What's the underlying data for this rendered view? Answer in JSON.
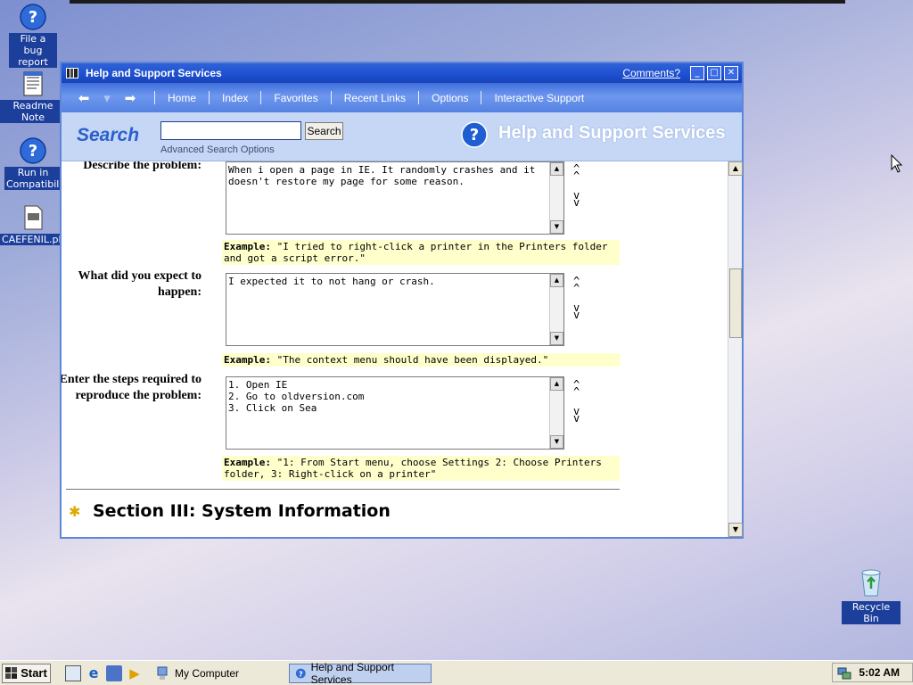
{
  "desktop": {
    "icons": [
      {
        "label": "File a bug report"
      },
      {
        "label": "Readme Note"
      },
      {
        "label": "Run in Compatibil..."
      },
      {
        "label": "CAEFENIL.ph"
      }
    ],
    "recycle_bin": "Recycle Bin"
  },
  "window": {
    "title": "Help and Support Services",
    "comments_link": "Comments?",
    "nav": {
      "items": [
        "Home",
        "Index",
        "Favorites",
        "Recent Links",
        "Options",
        "Interactive Support"
      ]
    },
    "search": {
      "label": "Search",
      "input_value": "",
      "button": "Search",
      "advanced": "Advanced Search Options",
      "brand_title": "Help and Support Services"
    },
    "form": {
      "q1_label": "Describe the problem:",
      "q1_value": "When i open a page in IE. It randomly crashes and it doesn't restore my page for some reason.",
      "q1_example_prefix": "Example:",
      "q1_example": " \"I tried to right-click a printer in the Printers folder and got a script error.\"",
      "q2_label": "What did you expect to happen:",
      "q2_value": "I expected it to not hang or crash.",
      "q2_example_prefix": "Example:",
      "q2_example": " \"The context menu should have been displayed.\"",
      "q3_label": "Enter the steps required to reproduce the problem:",
      "q3_value": "1. Open IE\n2. Go to oldversion.com\n3. Click on Sea",
      "q3_example_prefix": "Example:",
      "q3_example": " \"1: From Start menu, choose Settings 2: Choose Printers folder, 3: Right-click on a printer\"",
      "section_title": "Section III: System Information",
      "move_up": "^\n^",
      "move_down": "v\nv"
    }
  },
  "taskbar": {
    "start": "Start",
    "tasks": [
      "My Computer",
      "Help and Support Services"
    ],
    "clock": "5:02 AM"
  }
}
